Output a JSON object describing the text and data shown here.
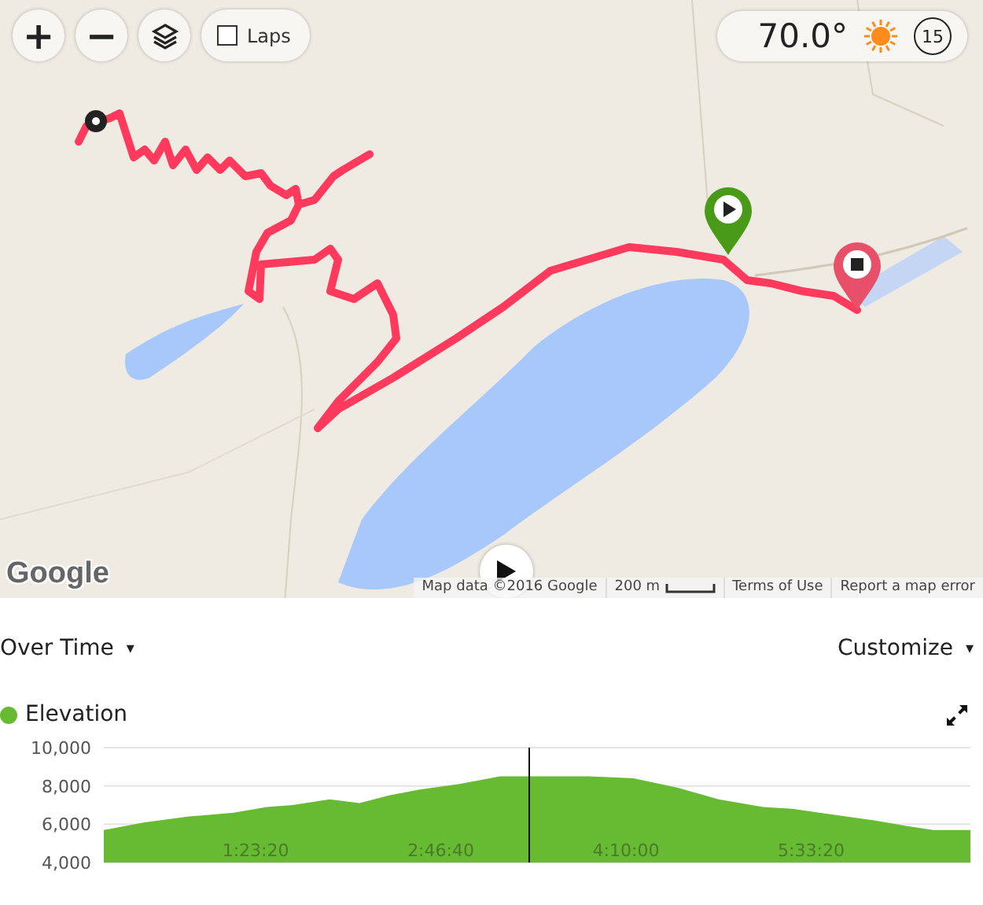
{
  "map": {
    "controls": {
      "zoom_in": "+",
      "zoom_out": "−",
      "laps": {
        "label": "Laps",
        "checked": false
      }
    },
    "weather": {
      "temperature": "70.0°",
      "wind": "15"
    },
    "logo": "Google",
    "attribution": [
      {
        "kind": "text",
        "label": "Map data ©2016 Google"
      },
      {
        "kind": "scale",
        "label": "200 m"
      },
      {
        "kind": "link",
        "label": "Terms of Use"
      },
      {
        "kind": "link",
        "label": "Report a map error"
      }
    ]
  },
  "chart_controls": {
    "view": "Over Time",
    "view_caret": "▾",
    "customize": "Customize",
    "customize_caret": "▾"
  },
  "chart_data": {
    "type": "area",
    "x": [
      900,
      2000,
      3200,
      4400,
      5300,
      6000,
      7000,
      7800,
      8600,
      9400,
      10500,
      11600,
      12900,
      14000,
      15200,
      16400,
      17500,
      18700,
      19500,
      20600,
      21700,
      22600,
      23300,
      24300
    ],
    "series": [
      {
        "name": "Elevation",
        "color": "#66bb33",
        "values": [
          5700,
          6100,
          6400,
          6600,
          6900,
          7000,
          7300,
          7100,
          7500,
          7800,
          8100,
          8500,
          8500,
          8500,
          8400,
          7900,
          7300,
          6900,
          6800,
          6500,
          6200,
          5900,
          5700,
          5700
        ]
      }
    ],
    "ylim": [
      4000,
      10000
    ],
    "yticks": [
      {
        "value": 4000,
        "label": "4,000"
      },
      {
        "value": 6000,
        "label": "6,000"
      },
      {
        "value": 8000,
        "label": "8,000"
      },
      {
        "value": 10000,
        "label": "10,000"
      }
    ],
    "xticks": [
      {
        "value": 5000,
        "label": "1:23:20"
      },
      {
        "value": 10000,
        "label": "2:46:40"
      },
      {
        "value": 15000,
        "label": "4:10:00"
      },
      {
        "value": 20000,
        "label": "5:33:20"
      }
    ],
    "xlim": [
      900,
      24300
    ]
  }
}
